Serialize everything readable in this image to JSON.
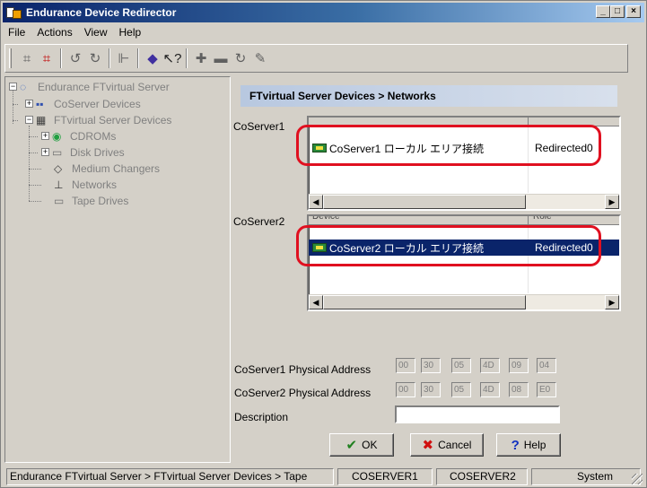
{
  "window": {
    "title": "Endurance Device Redirector",
    "min_glyph": "_",
    "max_glyph": "□",
    "close_glyph": "×"
  },
  "menu": [
    "File",
    "Actions",
    "View",
    "Help"
  ],
  "tree": {
    "root": "Endurance FTvirtual Server",
    "coserver_devices": "CoServer Devices",
    "ftvirtual_devices": "FTvirtual Server Devices",
    "cdroms": "CDROMs",
    "disk_drives": "Disk Drives",
    "medium_changers": "Medium Changers",
    "networks": "Networks",
    "tape_drives": "Tape Drives"
  },
  "panel": {
    "header": "FTvirtual Server Devices > Networks",
    "coserver1_label": "CoServer1",
    "coserver2_label": "CoServer2",
    "list1": {
      "header_fragment": "",
      "rows": [
        {
          "name": "CoServer1 ローカル エリア接続",
          "status": "Redirected0",
          "selected": false
        }
      ]
    },
    "list2": {
      "header_col1": "Device",
      "header_col2": "Role",
      "rows": [
        {
          "name": "CoServer2 ローカル エリア接続",
          "status": "Redirected0",
          "selected": true
        }
      ]
    },
    "addr1_label": "CoServer1 Physical Address",
    "addr1": [
      "00",
      "30",
      "05",
      "4D",
      "09",
      "04"
    ],
    "addr2_label": "CoServer2 Physical Address",
    "addr2": [
      "00",
      "30",
      "05",
      "4D",
      "08",
      "E0"
    ],
    "description_label": "Description",
    "description_value": ""
  },
  "buttons": {
    "ok": "OK",
    "cancel": "Cancel",
    "help": "Help"
  },
  "statusbar": {
    "path": "Endurance FTvirtual Server > FTvirtual Server Devices > Tape",
    "cell2": "COSERVER1",
    "cell3": "COSERVER2",
    "cell4": "System"
  },
  "colors": {
    "titlebar_start": "#0a246a",
    "selection": "#0a246a",
    "callout": "#e01020",
    "ok_check": "#208020",
    "cancel_x": "#d01010",
    "help_q": "#1030c0"
  }
}
